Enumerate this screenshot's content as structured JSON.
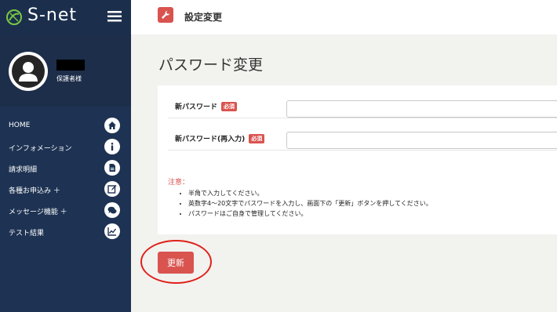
{
  "app": {
    "brand": "S-net"
  },
  "user": {
    "role": "保護者様"
  },
  "sidebar": {
    "items": [
      {
        "label": "HOME",
        "icon": "home-icon"
      },
      {
        "label": "インフォメーション",
        "icon": "info-icon"
      },
      {
        "label": "請求明細",
        "icon": "document-icon"
      },
      {
        "label": "各種お申込み ＋",
        "icon": "edit-icon"
      },
      {
        "label": "メッセージ機能 ＋",
        "icon": "chat-icon"
      },
      {
        "label": "テスト結果",
        "icon": "chart-icon"
      }
    ]
  },
  "header": {
    "title": "設定変更",
    "icon": "wrench-icon"
  },
  "main": {
    "title": "パスワード変更",
    "fields": [
      {
        "label": "新パスワード",
        "required": "必須",
        "value": ""
      },
      {
        "label": "新パスワード(再入力)",
        "required": "必須",
        "value": ""
      }
    ],
    "notes": {
      "title": "注意：",
      "items": [
        "半角で入力してください。",
        "英数字4～20文字でパスワードを入力し、画面下の「更新」ボタンを押してください。",
        "パスワードはご自身で管理してください。"
      ]
    },
    "submit_label": "更新"
  },
  "colors": {
    "sidebar": "#1e3353",
    "accent": "#d9534f",
    "highlight": "#e0201a",
    "background": "#f2f2ef"
  }
}
